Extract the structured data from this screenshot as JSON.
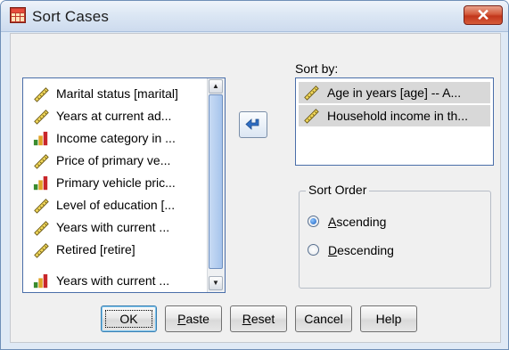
{
  "window": {
    "title": "Sort Cases",
    "close_symbol": "✕",
    "icon": "table-grid-icon"
  },
  "variables": {
    "items": [
      {
        "label": "Marital status [marital]",
        "icon": "ruler-scale-icon"
      },
      {
        "label": "Years at current ad...",
        "icon": "ruler-scale-icon"
      },
      {
        "label": "Income category in ...",
        "icon": "bar-chart-ordinal-icon"
      },
      {
        "label": "Price of primary ve...",
        "icon": "ruler-scale-icon"
      },
      {
        "label": "Primary vehicle pric...",
        "icon": "bar-chart-ordinal-icon"
      },
      {
        "label": "Level of education [...",
        "icon": "ruler-scale-icon"
      },
      {
        "label": "Years with current ...",
        "icon": "ruler-scale-icon"
      },
      {
        "label": "Retired [retire]",
        "icon": "ruler-scale-icon"
      },
      {
        "label": "Years with current ...",
        "icon": "bar-chart-ordinal-icon"
      }
    ],
    "scroll_up": "▲",
    "scroll_down": "▼"
  },
  "move_button": {
    "icon": "arrow-left-icon"
  },
  "sort_by": {
    "label": "Sort by:",
    "items": [
      {
        "label": "Age in years [age] -- A...",
        "icon": "ruler-scale-icon"
      },
      {
        "label": "Household income in th...",
        "icon": "ruler-scale-icon"
      }
    ]
  },
  "sort_order": {
    "legend": "Sort Order",
    "ascending": {
      "mnemonic": "A",
      "rest": "scending",
      "selected": true
    },
    "descending": {
      "mnemonic": "D",
      "rest": "escending",
      "selected": false
    }
  },
  "buttons": {
    "ok": "OK",
    "paste": {
      "mnemonic": "P",
      "rest": "aste"
    },
    "reset": {
      "mnemonic": "R",
      "rest": "eset"
    },
    "cancel": "Cancel",
    "help": "Help"
  },
  "colors": {
    "selected_item": "#d8d8d8",
    "close_button": "#c2361c",
    "list_border": "#4a6ea9"
  }
}
